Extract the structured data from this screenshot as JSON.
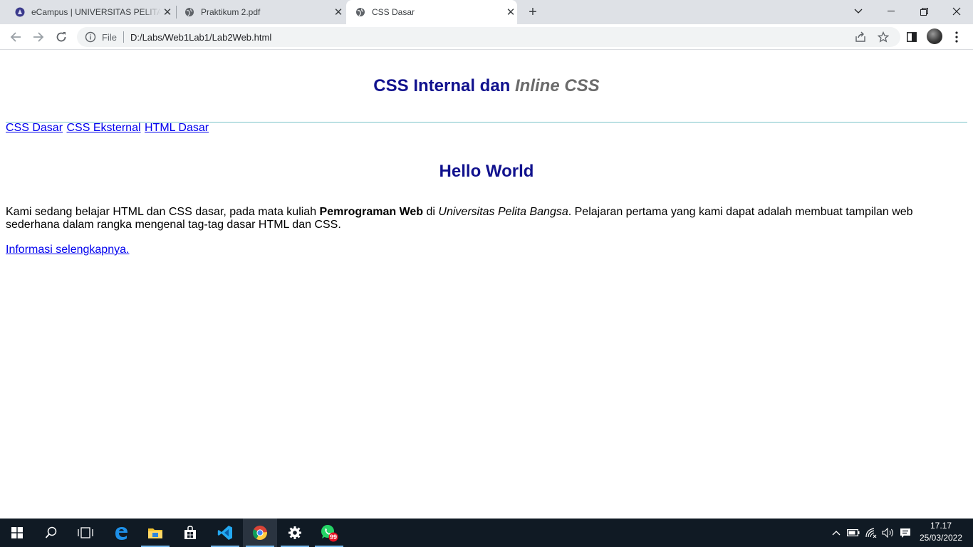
{
  "browser": {
    "tabs": [
      {
        "title": "eCampus | UNIVERSITAS PELITA B",
        "favicon": "university-logo-icon"
      },
      {
        "title": "Praktikum 2.pdf",
        "favicon": "globe-icon"
      },
      {
        "title": "CSS Dasar",
        "favicon": "globe-icon",
        "active": true
      }
    ],
    "address": {
      "scheme_label": "File",
      "url": "D:/Labs/Web1Lab1/Lab2Web.html"
    }
  },
  "page": {
    "header": {
      "title_main": "CSS Internal dan ",
      "title_italic": "Inline CSS"
    },
    "nav_links": [
      "CSS Dasar",
      "CSS Eksternal",
      "HTML Dasar"
    ],
    "heading": "Hello World",
    "paragraph": {
      "part1": "Kami sedang belajar HTML dan CSS dasar, pada mata kuliah ",
      "bold": "Pemrograman Web",
      "part2": " di ",
      "italic": "Universitas Pelita Bangsa",
      "part3": ". Pelajaran pertama yang kami dapat adalah membuat tampilan web sederhana dalam rangka mengenal tag-tag dasar HTML dan CSS."
    },
    "more_link": "Informasi selengkapnya."
  },
  "taskbar": {
    "apps": [
      "start-icon",
      "search-icon",
      "task-view-icon",
      "edge-icon",
      "file-explorer-icon",
      "store-icon",
      "vscode-icon",
      "chrome-icon",
      "settings-icon",
      "whatsapp-icon"
    ],
    "whatsapp_badge": "99",
    "time": "17.17",
    "date": "25/03/2022"
  },
  "colors": {
    "heading": "#11128e",
    "italic_grey": "#6b6b6b",
    "link": "#0000ee",
    "rule": "#7cc4c8",
    "taskbar": "#101a24"
  }
}
